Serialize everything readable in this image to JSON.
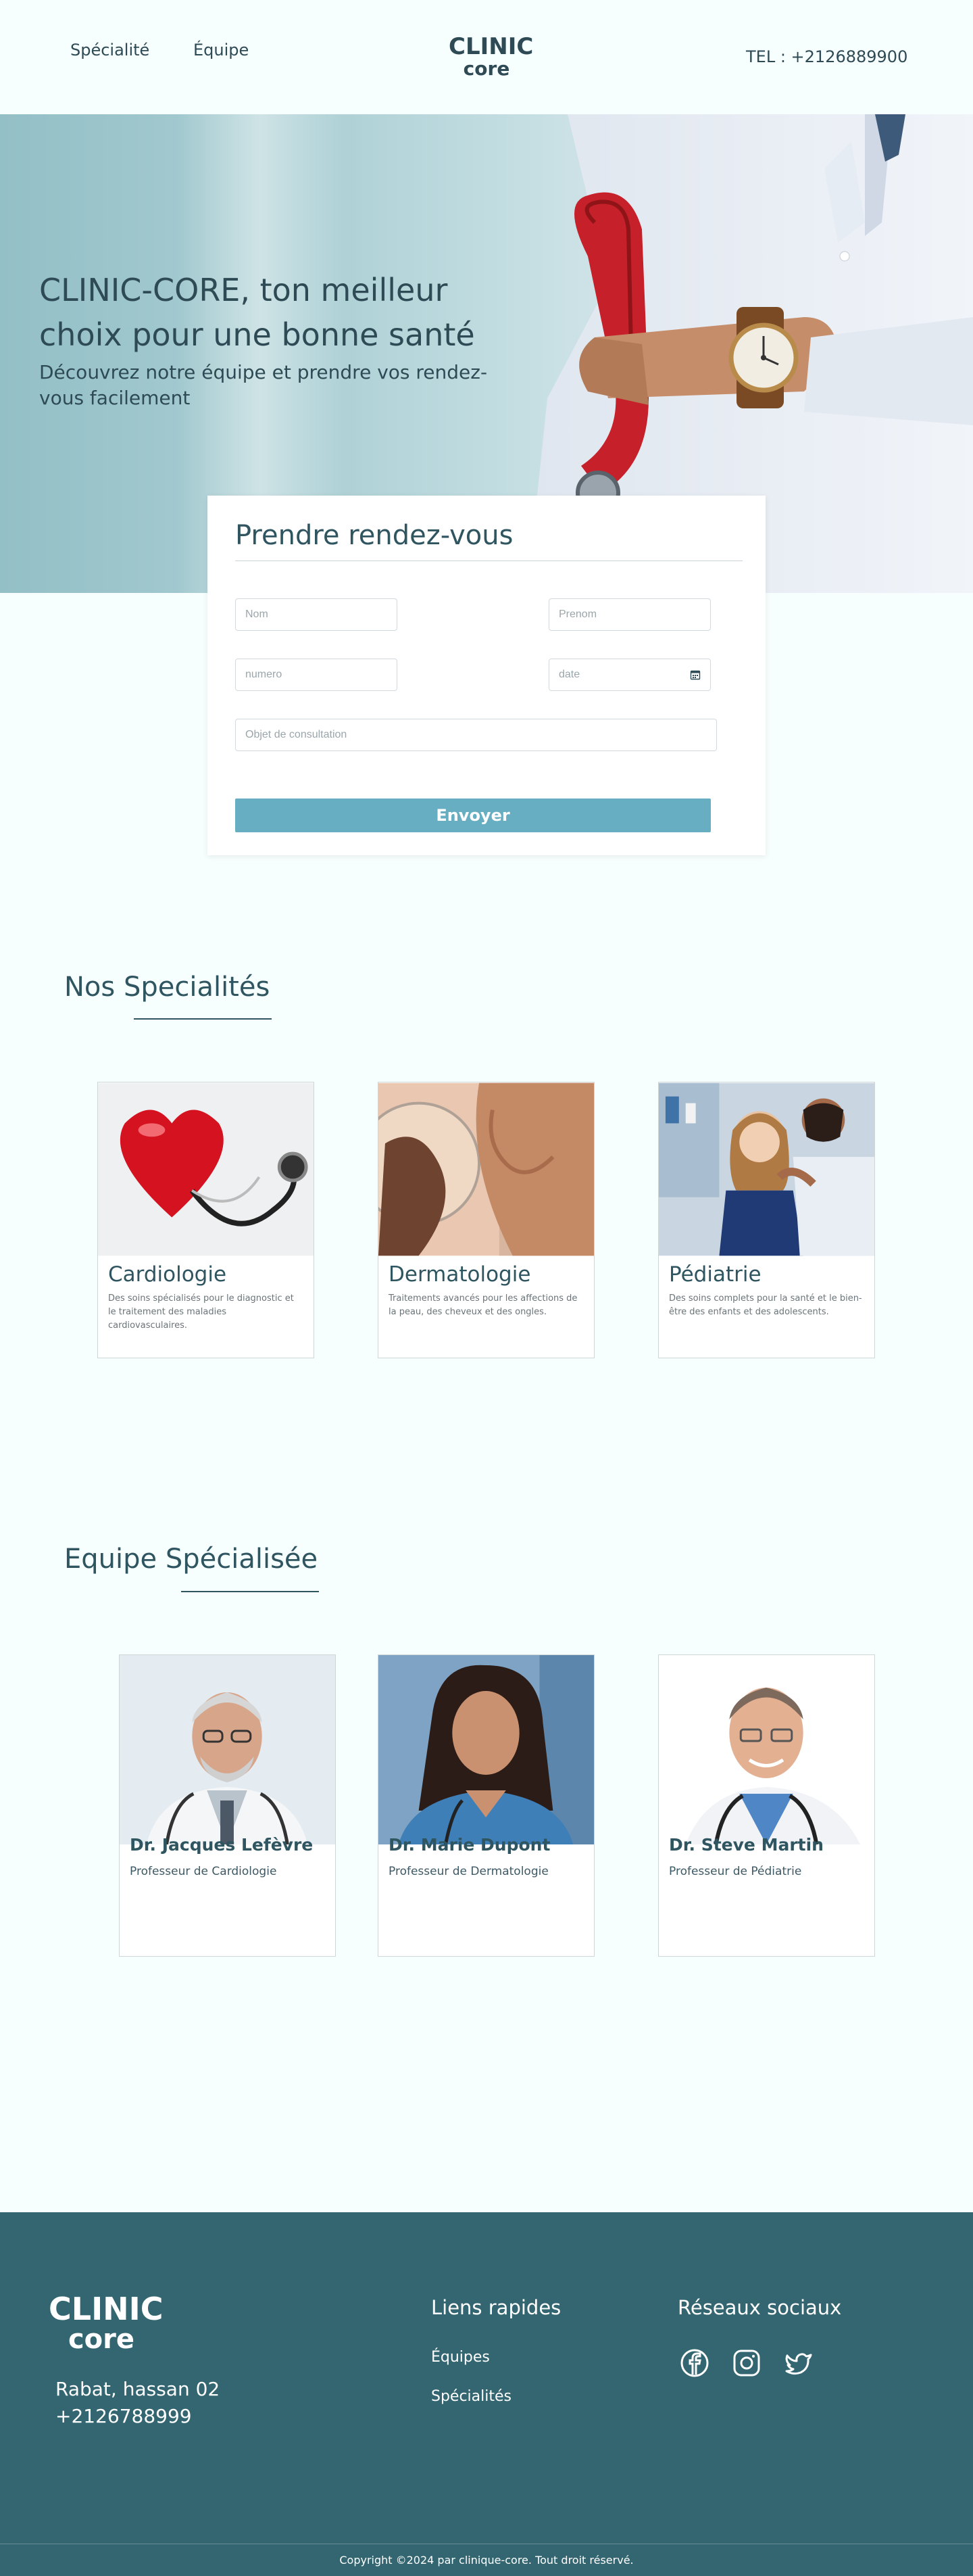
{
  "header": {
    "nav": [
      "Spécialité",
      "Équipe"
    ],
    "logo_line1": "CLINIC",
    "logo_line2": "core",
    "tel": "TEL : +2126889900"
  },
  "hero": {
    "title": "CLINIC-CORE, ton meilleur choix pour une bonne santé",
    "subtitle": "Découvrez notre équipe et prendre vos rendez-vous facilement"
  },
  "form": {
    "title": "Prendre rendez-vous",
    "placeholders": {
      "nom": "Nom",
      "prenom": "Prenom",
      "numero": "numero",
      "date": "date",
      "objet": "Objet de consultation"
    },
    "submit_label": "Envoyer"
  },
  "specialites": {
    "title": "Nos Specialités",
    "items": [
      {
        "name": "Cardiologie",
        "desc": "Des soins spécialisés pour le diagnostic et le traitement des maladies cardiovasculaires."
      },
      {
        "name": "Dermatologie",
        "desc": "Traitements avancés pour les affections de la peau, des cheveux et des ongles."
      },
      {
        "name": "Pédiatrie",
        "desc": "Des soins complets pour la santé et le bien-être des enfants et des adolescents."
      }
    ]
  },
  "equipe": {
    "title": "Equipe Spécialisée",
    "members": [
      {
        "name": "Dr. Jacques Lefèvre",
        "role": "Professeur de Cardiologie"
      },
      {
        "name": "Dr. Marie Dupont",
        "role": "Professeur de Dermatologie"
      },
      {
        "name": "Dr. Steve Martin",
        "role": "Professeur de Pédiatrie"
      }
    ]
  },
  "footer": {
    "logo_line1": "CLINIC",
    "logo_line2": "core",
    "address": "Rabat, hassan 02",
    "phone": "+2126788999",
    "links_title": "Liens rapides",
    "links": [
      "Équipes",
      "Spécialités"
    ],
    "social_title": "Réseaux sociaux",
    "social_icons": [
      "facebook-icon",
      "instagram-icon",
      "twitter-icon"
    ],
    "copyright": "Copyright ©2024 par clinique-core. Tout droit réservé."
  },
  "colors": {
    "primary_dark": "#2e4a55",
    "button": "#67aec2",
    "footer_bg": "#336671",
    "page_bg": "#f7fefe"
  }
}
